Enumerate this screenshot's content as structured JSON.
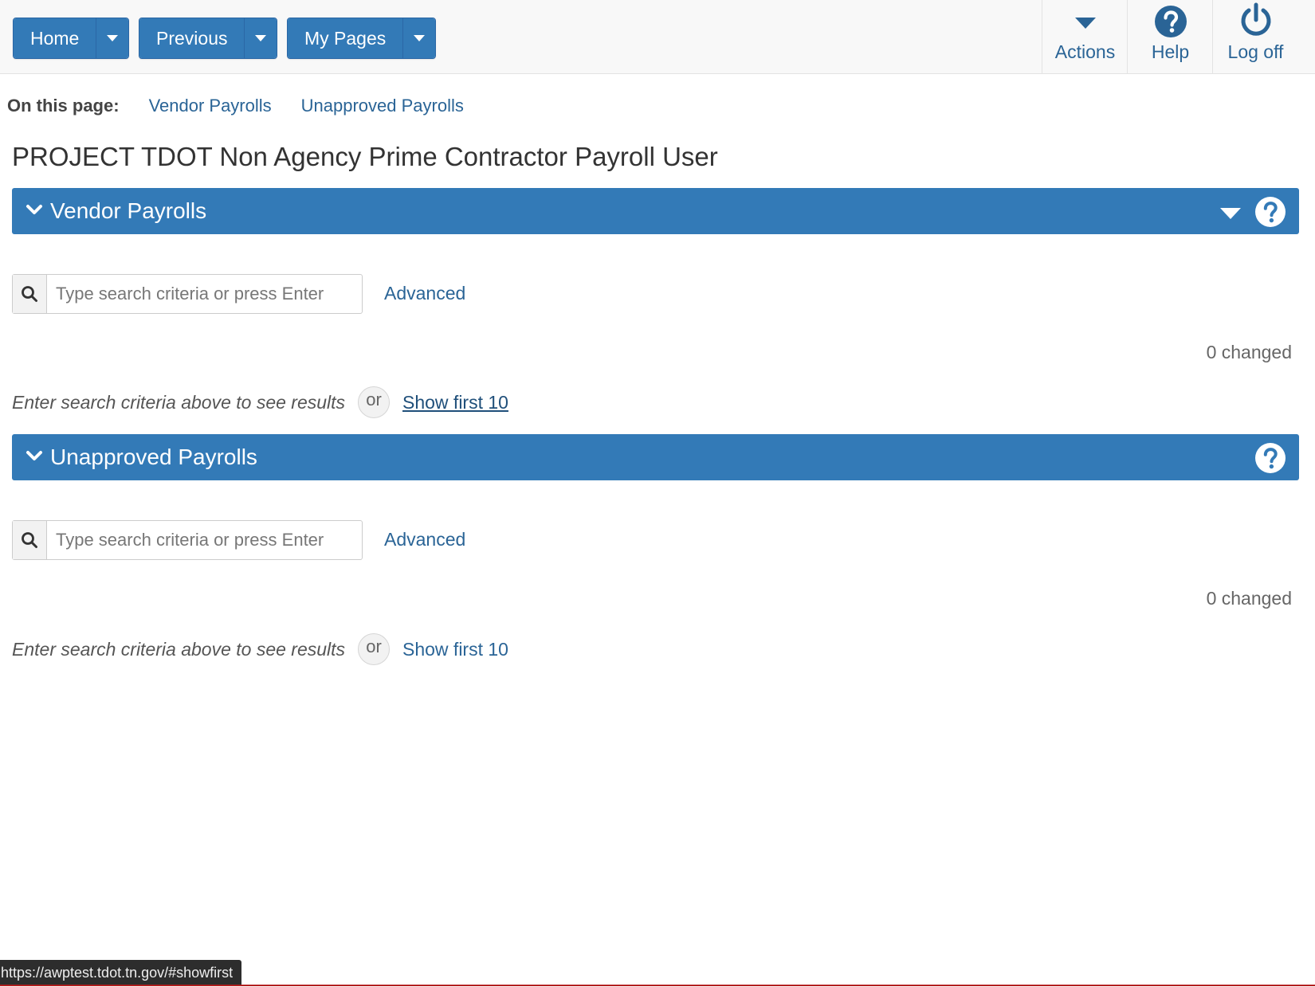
{
  "nav": {
    "home": "Home",
    "previous": "Previous",
    "my_pages": "My Pages"
  },
  "tools": {
    "actions": "Actions",
    "help": "Help",
    "logoff": "Log off"
  },
  "anchors": {
    "lead": "On this page:",
    "vendor": "Vendor Payrolls",
    "unapproved": "Unapproved Payrolls"
  },
  "page_title": "PROJECT TDOT Non Agency Prime Contractor Payroll User",
  "sections": [
    {
      "title": "Vendor Payrolls",
      "search_placeholder": "Type search criteria or press Enter",
      "advanced": "Advanced",
      "changed": "0 changed",
      "hint": "Enter search criteria above to see results",
      "or": "or",
      "show_first": "Show first 10"
    },
    {
      "title": "Unapproved Payrolls",
      "search_placeholder": "Type search criteria or press Enter",
      "advanced": "Advanced",
      "changed": "0 changed",
      "hint": "Enter search criteria above to see results",
      "or": "or",
      "show_first": "Show first 10"
    }
  ],
  "status_url": "https://awptest.tdot.tn.gov/#showfirst",
  "colors": {
    "primary": "#337ab7",
    "link": "#2a6496",
    "topbar_bg": "#f8f8f8",
    "status_bar": "#2d2d2d",
    "bottom_rule": "#b21f1f"
  },
  "icons": {
    "nav_dropdown": "caret-down-icon",
    "actions": "caret-down-icon",
    "help": "question-circle-icon",
    "logoff": "power-icon",
    "panel_collapse": "chevron-down-icon",
    "panel_help": "question-circle-icon",
    "search": "search-icon"
  }
}
